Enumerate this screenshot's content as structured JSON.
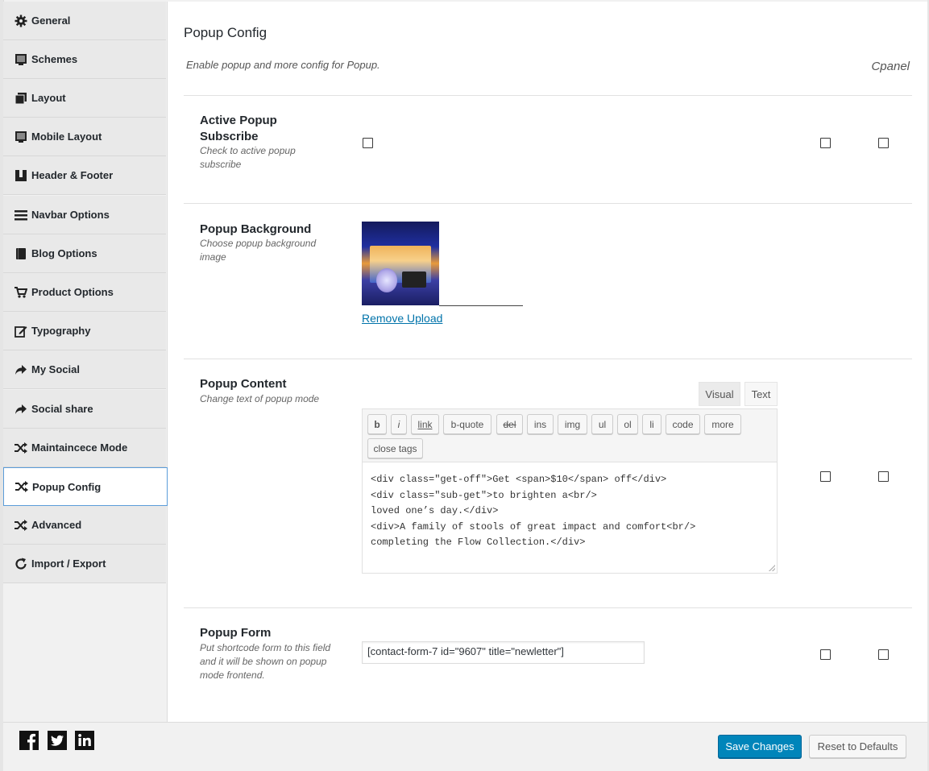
{
  "sidebar": {
    "items": [
      {
        "label": "General",
        "icon": "gear-icon"
      },
      {
        "label": "Schemes",
        "icon": "monitor-icon"
      },
      {
        "label": "Layout",
        "icon": "copy-icon"
      },
      {
        "label": "Mobile Layout",
        "icon": "monitor-icon"
      },
      {
        "label": "Header & Footer",
        "icon": "columns-icon"
      },
      {
        "label": "Navbar Options",
        "icon": "menu-icon"
      },
      {
        "label": "Blog Options",
        "icon": "book-icon"
      },
      {
        "label": "Product Options",
        "icon": "cart-icon"
      },
      {
        "label": "Typography",
        "icon": "edit-icon"
      },
      {
        "label": "My Social",
        "icon": "share-arrow-icon"
      },
      {
        "label": "Social share",
        "icon": "share-arrow-icon"
      },
      {
        "label": "Maintaincece Mode",
        "icon": "shuffle-icon"
      },
      {
        "label": "Popup Config",
        "icon": "shuffle-icon",
        "active": true
      },
      {
        "label": "Advanced",
        "icon": "shuffle-icon"
      },
      {
        "label": "Import / Export",
        "icon": "refresh-icon"
      }
    ]
  },
  "main": {
    "title": "Popup Config",
    "description": "Enable popup and more config for Popup.",
    "cpanel": "Cpanel",
    "fields": {
      "active_popup": {
        "label": "Active Popup Subscribe",
        "subtitle": "Check to active popup subscribe"
      },
      "popup_background": {
        "label": "Popup Background",
        "subtitle": "Choose popup background image",
        "remove_label": "Remove Upload"
      },
      "popup_content": {
        "label": "Popup Content",
        "subtitle": "Change text of popup mode",
        "tabs": [
          "Visual",
          "Text"
        ],
        "quicktags": [
          "b",
          "i",
          "link",
          "b-quote",
          "del",
          "ins",
          "img",
          "ul",
          "ol",
          "li",
          "code",
          "more",
          "close tags"
        ],
        "lines": [
          "<div class=\"get-off\">Get <span>$10</span> off</div>",
          "<div class=\"sub-get\">to brighten a<br/>",
          "loved one’s day.</div>",
          "<div>A family of stools of great impact and comfort<br/>",
          "completing the Flow Collection.</div>"
        ]
      },
      "popup_form": {
        "label": "Popup Form",
        "subtitle": "Put shortcode form to this field and it will be shown on popup mode frontend.",
        "value": "[contact-form-7 id=\"9607\" title=\"newletter\"]"
      }
    }
  },
  "footer": {
    "save_label": "Save Changes",
    "reset_label": "Reset to Defaults",
    "social": [
      "facebook-icon",
      "twitter-icon",
      "linkedin-icon"
    ]
  },
  "colors": {
    "primary": "#0085ba",
    "link": "#0073aa",
    "active_border": "#5b9dd9"
  }
}
